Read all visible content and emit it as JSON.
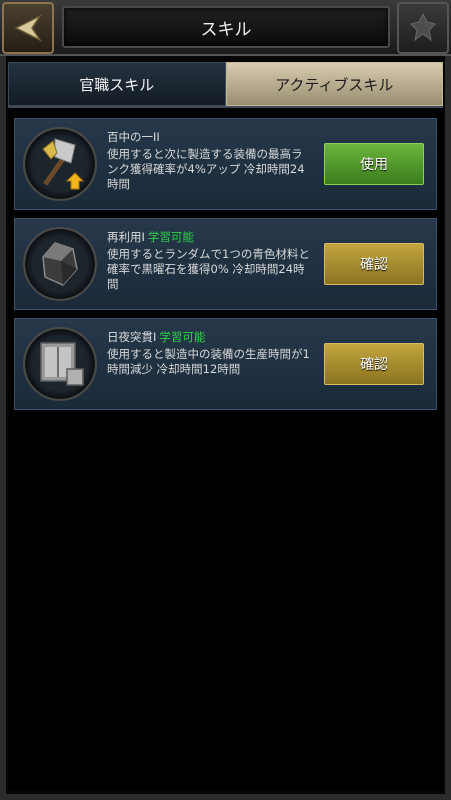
{
  "header": {
    "title": "スキル"
  },
  "tabs": [
    {
      "label": "官職スキル",
      "active": false
    },
    {
      "label": "アクティブスキル",
      "active": true
    }
  ],
  "skills": [
    {
      "name": "百中の一II",
      "badge": "",
      "description": "使用すると次に製造する装備の最高ランク獲得確率が4%アップ 冷却時間24時間",
      "action_label": "使用",
      "icon": "axe-upgrade-icon"
    },
    {
      "name": "再利用I",
      "badge": "学習可能",
      "description": "使用するとランダムで1つの青色材料と確率で黒曜石を獲得0% 冷却時間24時間",
      "action_label": "確認",
      "icon": "obsidian-stone-icon"
    },
    {
      "name": "日夜突貫I",
      "badge": "学習可能",
      "description": "使用すると製造中の装備の生産時間が1時間減少 冷却時間12時間",
      "action_label": "確認",
      "icon": "armor-crate-icon"
    }
  ],
  "colors": {
    "use_button": "#4f9a2a",
    "check_button": "#a88d2e",
    "learnable_text": "#2fd14a",
    "card_background": "#22334a"
  }
}
